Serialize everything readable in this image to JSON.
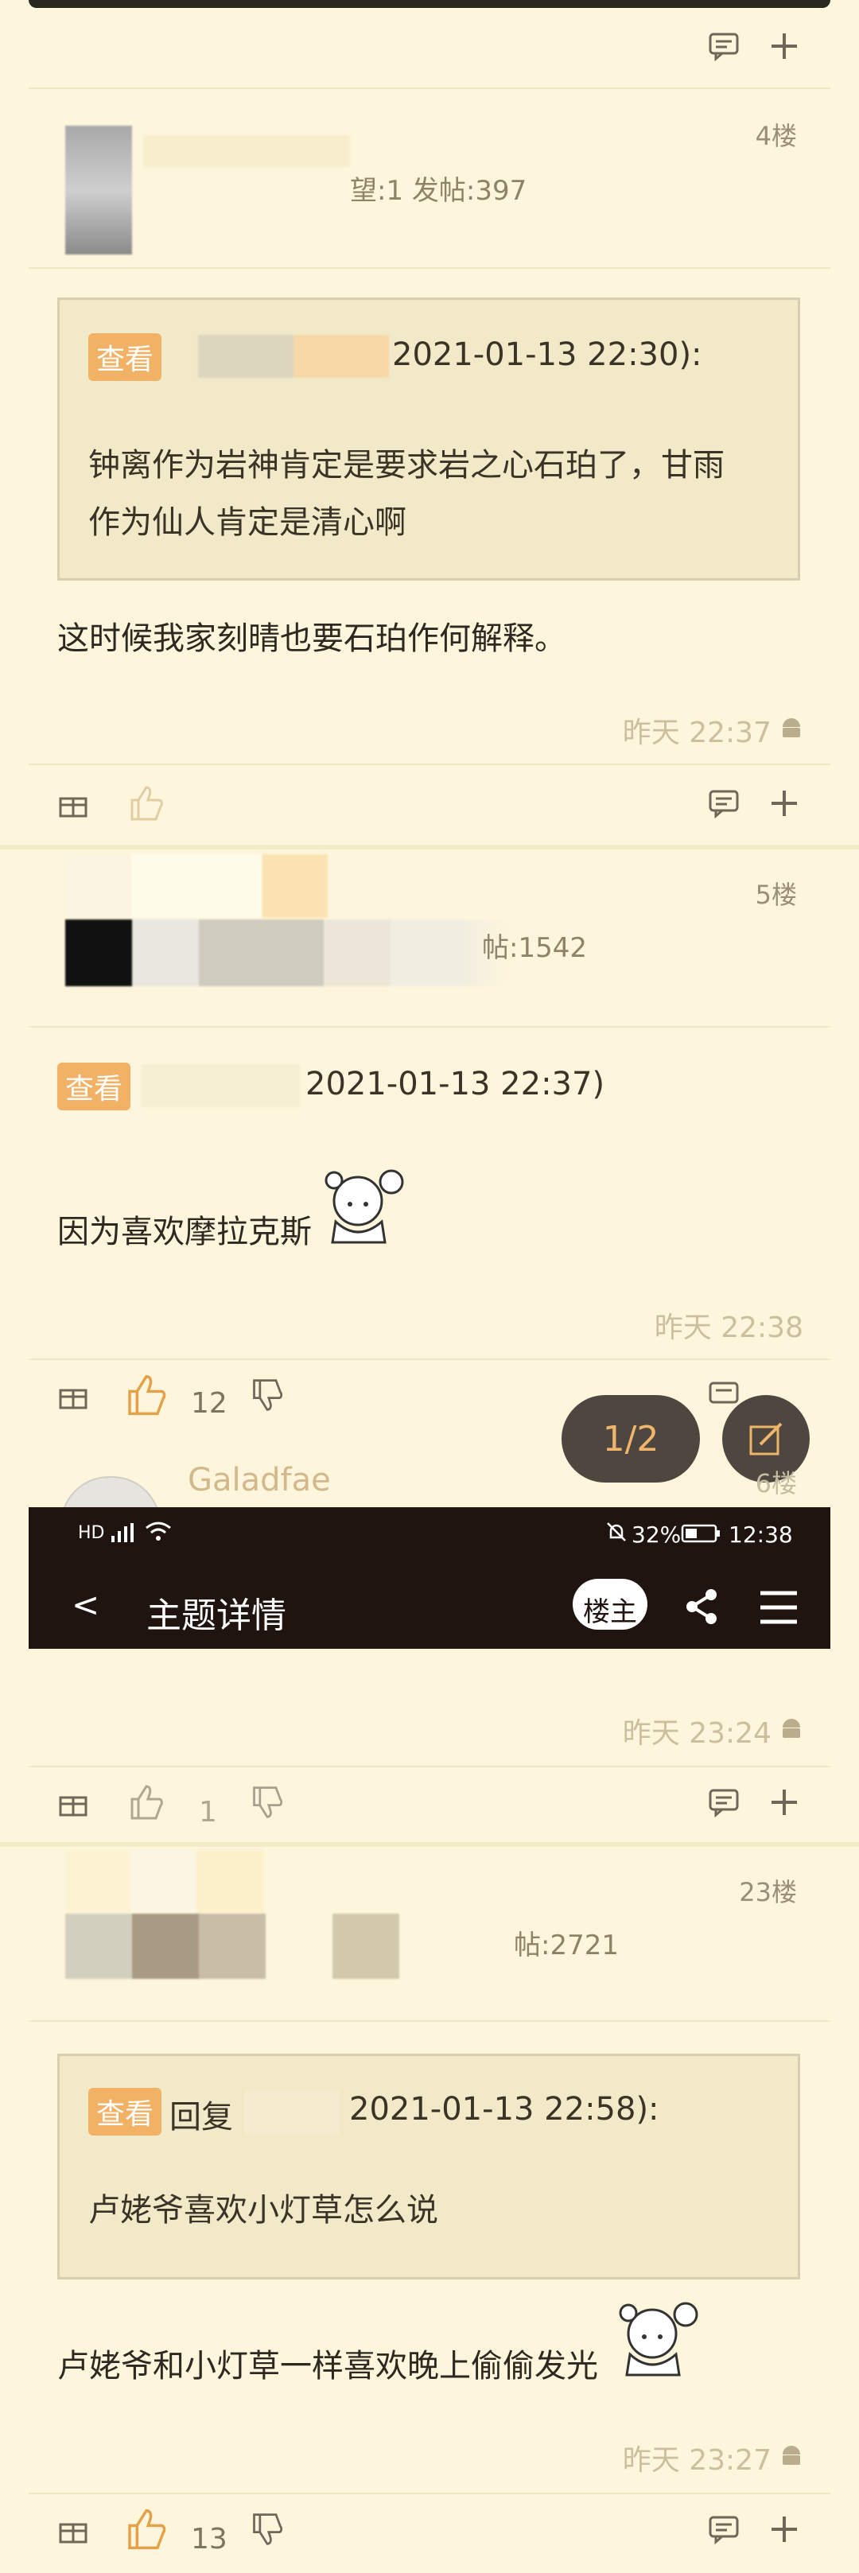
{
  "posts": [
    {
      "floor": "4楼",
      "user_meta": "望:1  发帖:397",
      "quote": {
        "chip": "查看",
        "head": "2021-01-13 22:30):",
        "body_lines": [
          "钟离作为岩神肯定是要求岩之心石珀了，甘雨",
          "作为仙人肯定是清心啊"
        ]
      },
      "text": "这时候我家刻晴也要石珀作何解释。",
      "time": "昨天 22:37"
    },
    {
      "floor": "5楼",
      "user_meta": "帖:1542",
      "quote": {
        "chip": "查看",
        "head": "2021-01-13 22:37)"
      },
      "text": "因为喜欢摩拉克斯",
      "time": "昨天 22:38",
      "likes": "12"
    },
    {
      "floor": "6楼",
      "username": "Galadfae",
      "time": "昨天 23:24",
      "likes": "1"
    },
    {
      "floor": "23楼",
      "user_meta": "帖:2721",
      "quote": {
        "chip": "查看",
        "reply": "回复",
        "head": "2021-01-13 22:58):",
        "body_lines": [
          "卢姥爷喜欢小灯草怎么说"
        ]
      },
      "text": "卢姥爷和小灯草一样喜欢晚上偷偷发光",
      "time": "昨天 23:27",
      "likes": "13"
    }
  ],
  "fab": {
    "page": "1/2"
  },
  "status_bar": {
    "left": "HD",
    "battery": "32%",
    "time": "12:38"
  },
  "nav": {
    "back_label": "<",
    "title": "主题详情",
    "owner_label": "楼主"
  },
  "colors": {
    "bg": "#fdf6dc",
    "accent": "#f1b266",
    "nav_bg": "#1f1410"
  },
  "icons": [
    "comment-icon",
    "plus-icon",
    "gift-icon",
    "like-icon",
    "dislike-icon",
    "android-icon",
    "share-icon",
    "menu-icon",
    "edit-icon"
  ]
}
